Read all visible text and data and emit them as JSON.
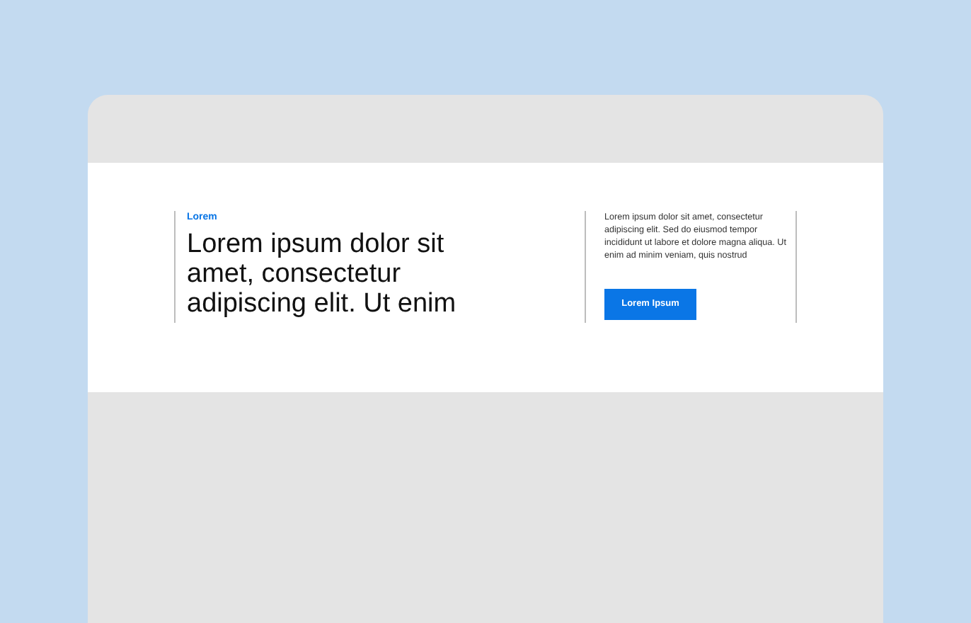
{
  "hero": {
    "eyebrow": "Lorem",
    "heading": "Lorem ipsum dolor sit amet, consectetur adipiscing elit. Ut enim",
    "body": "Lorem ipsum dolor sit amet, consectetur adipiscing elit. Sed do eiusmod tempor incididunt ut labore et dolore magna aliqua. Ut enim ad minim veniam, quis nostrud",
    "button": "Lorem Ipsum"
  }
}
